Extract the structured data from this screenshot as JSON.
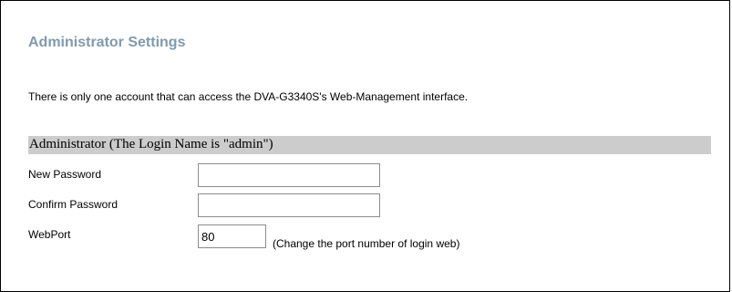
{
  "page": {
    "title": "Administrator Settings",
    "description": "There is only one account that can access the DVA-G3340S's Web-Management interface."
  },
  "section": {
    "header": "Administrator (The Login Name is \"admin\")"
  },
  "form": {
    "new_password": {
      "label": "New Password",
      "value": ""
    },
    "confirm_password": {
      "label": "Confirm Password",
      "value": ""
    },
    "webport": {
      "label": "WebPort",
      "value": "80",
      "hint": "(Change the port number of login web)"
    }
  },
  "colors": {
    "title": "#7f9aaf",
    "section_header_bg": "#cccccc"
  }
}
